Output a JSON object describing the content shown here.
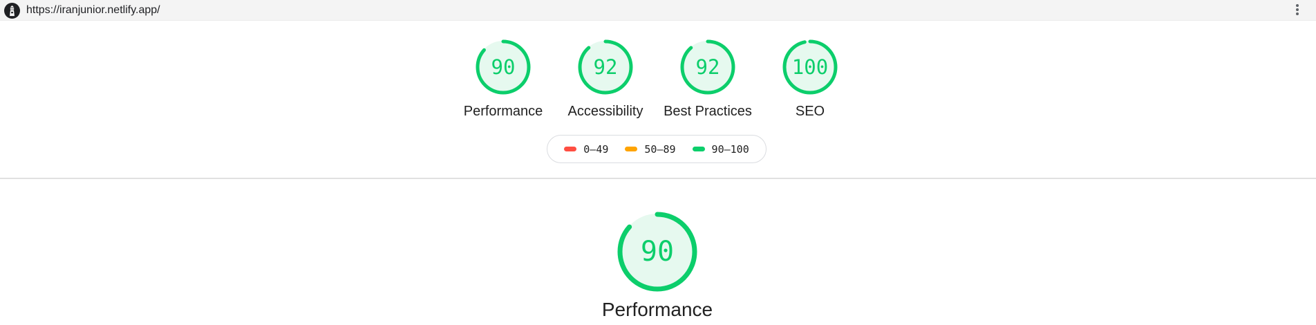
{
  "address_bar": {
    "url": "https://iranjunior.netlify.app/"
  },
  "icons": {
    "logo": "lighthouse-icon",
    "menu": "more-vert-icon"
  },
  "colors": {
    "pass": "#0cce6b",
    "pass_bg": "#e6f9ef",
    "average": "#ffa400",
    "fail": "#ff4e42"
  },
  "categories": [
    {
      "label": "Performance",
      "score": 90
    },
    {
      "label": "Accessibility",
      "score": 92
    },
    {
      "label": "Best Practices",
      "score": 92
    },
    {
      "label": "SEO",
      "score": 100
    }
  ],
  "legend": [
    {
      "range": "0–49",
      "color": "#ff4e42"
    },
    {
      "range": "50–89",
      "color": "#ffa400"
    },
    {
      "range": "90–100",
      "color": "#0cce6b"
    }
  ],
  "focus": {
    "label": "Performance",
    "score": 90
  }
}
